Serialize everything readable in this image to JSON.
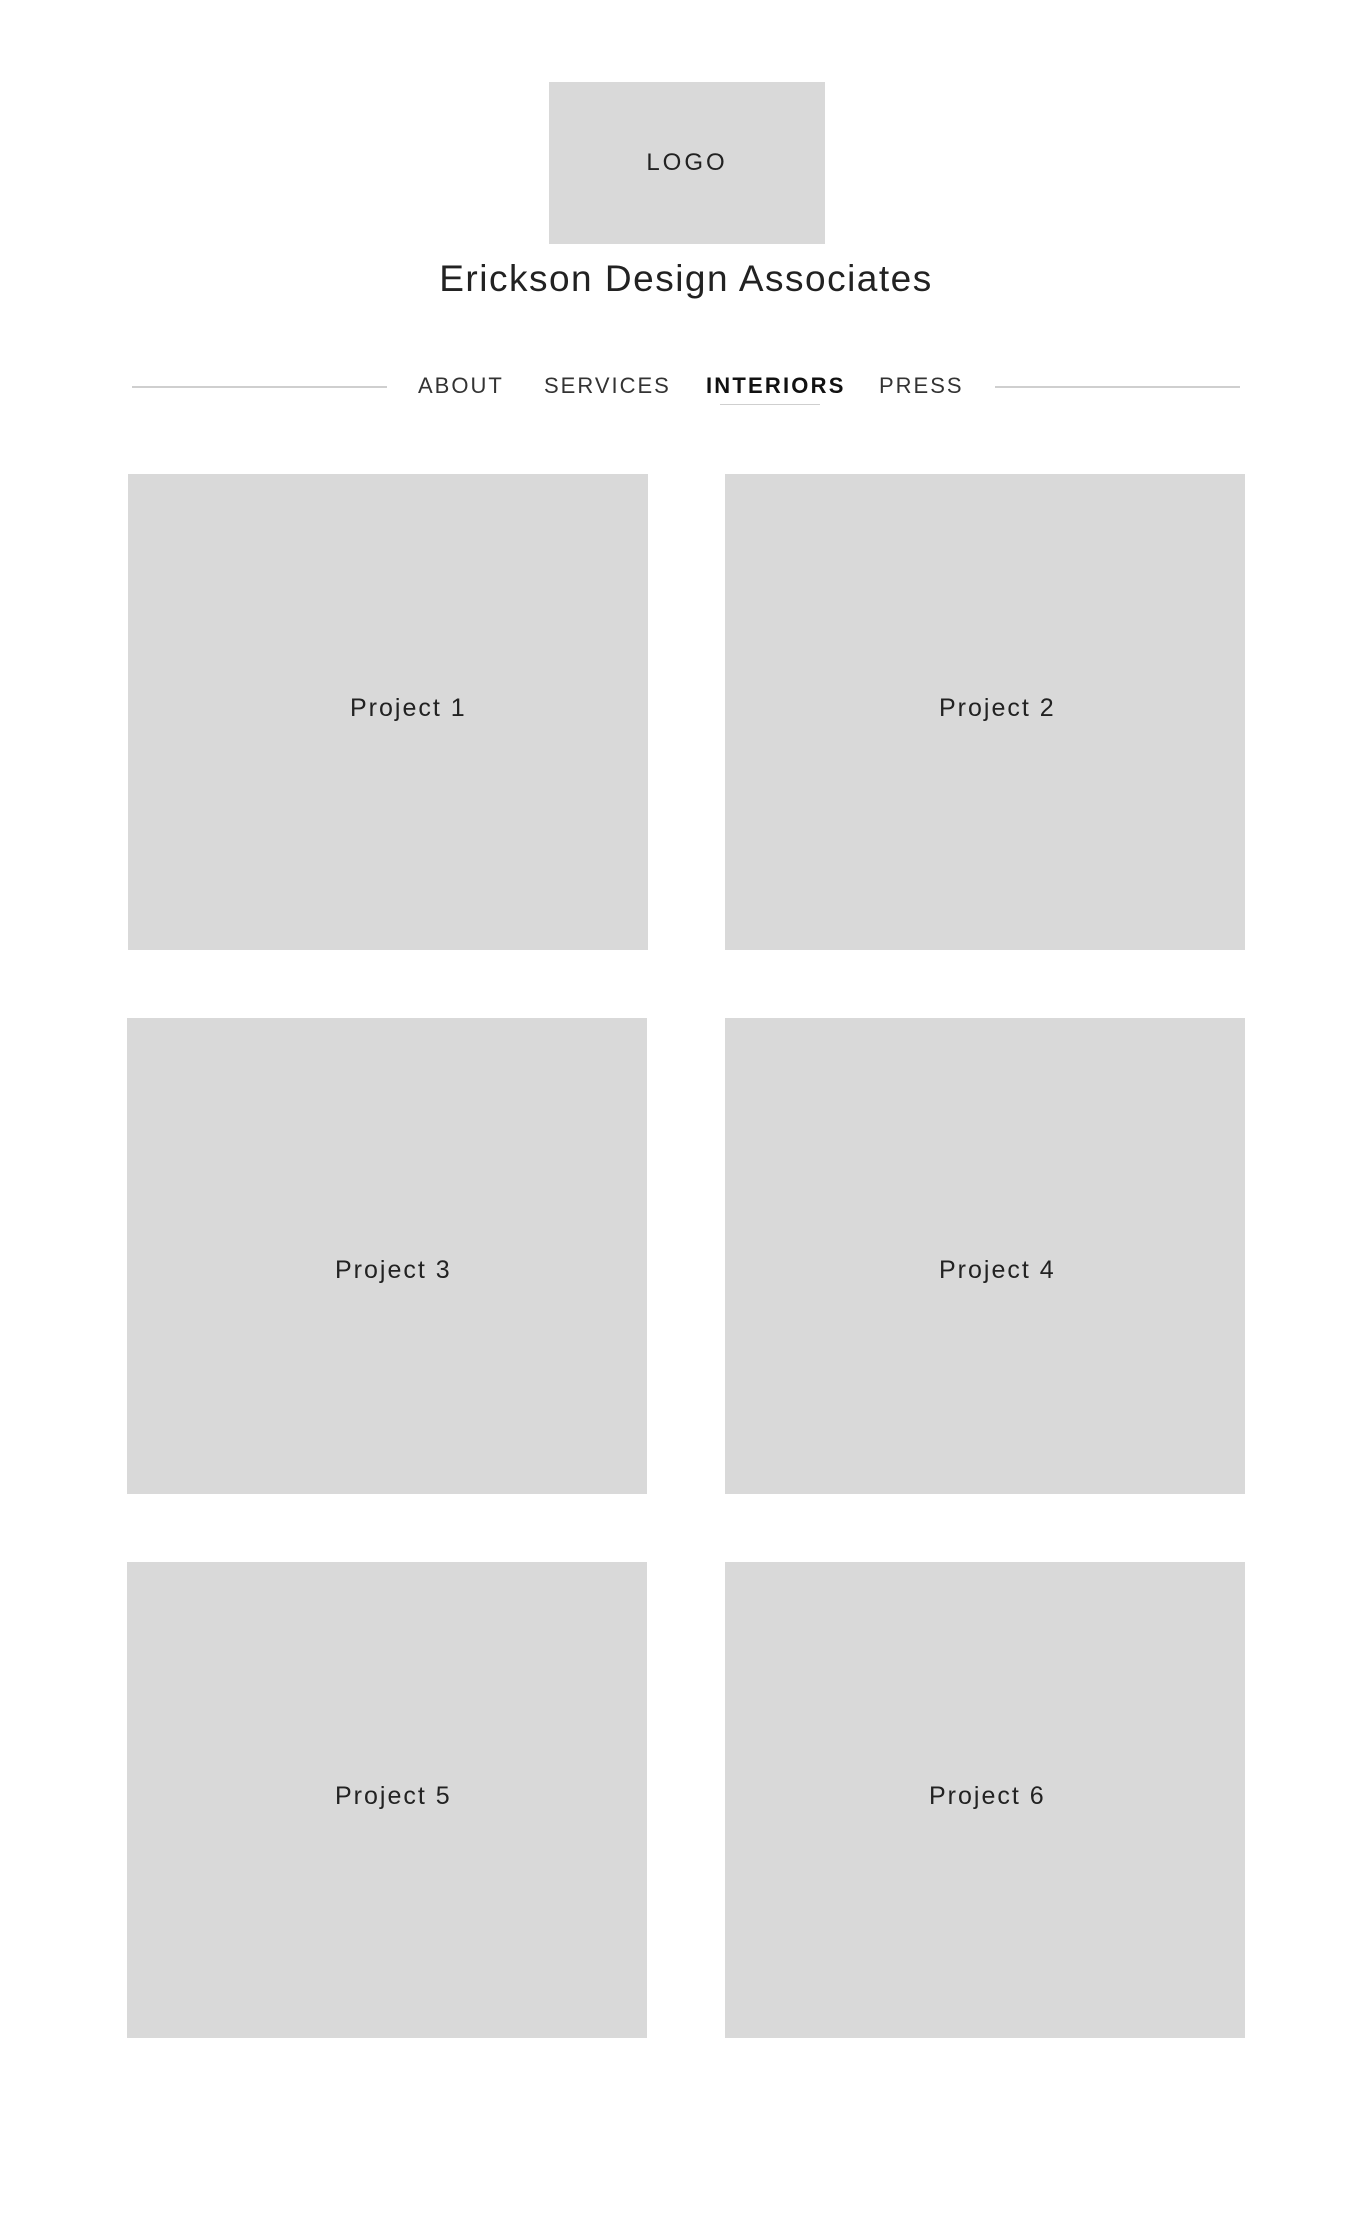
{
  "header": {
    "logo_text": "LOGO",
    "site_title": "Erickson Design Associates"
  },
  "nav": {
    "items": [
      {
        "label": "ABOUT",
        "active": false
      },
      {
        "label": "SERVICES",
        "active": false
      },
      {
        "label": "INTERIORS",
        "active": true
      },
      {
        "label": "PRESS",
        "active": false
      }
    ]
  },
  "projects": [
    {
      "label": "Project 1"
    },
    {
      "label": "Project 2"
    },
    {
      "label": "Project 3"
    },
    {
      "label": "Project 4"
    },
    {
      "label": "Project 5"
    },
    {
      "label": "Project 6"
    }
  ],
  "colors": {
    "placeholder_bg": "#d9d9d9",
    "divider": "#cfcfcf",
    "text": "#222222"
  }
}
